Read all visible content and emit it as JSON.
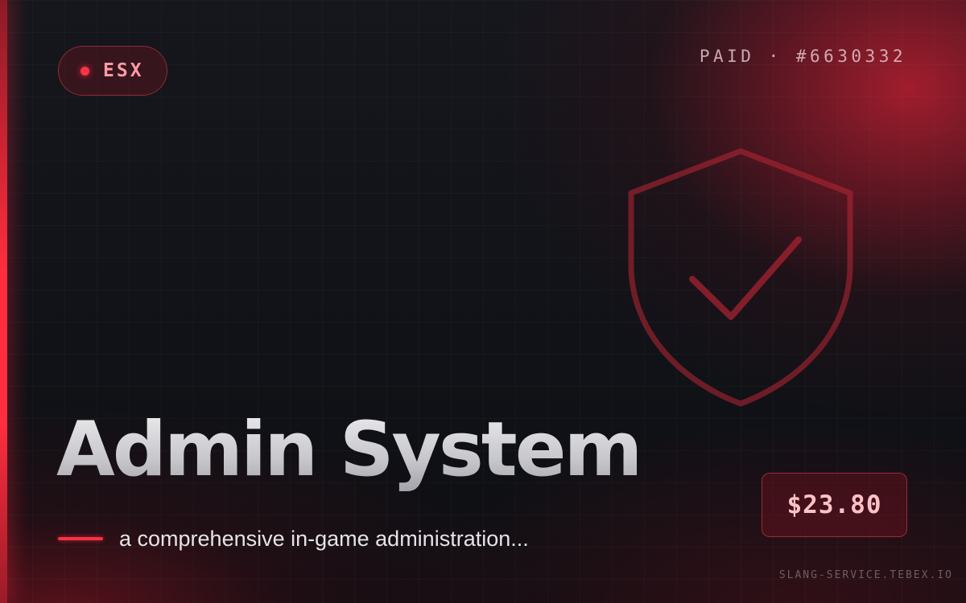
{
  "badge": {
    "label": "ESX"
  },
  "order": {
    "text": "PAID · #6630332"
  },
  "product": {
    "title": "Admin System",
    "description": "a comprehensive in-game administration...",
    "icon": "shield-check-icon"
  },
  "price": {
    "value": "$23.80"
  },
  "footer": {
    "domain": "SLANG-SERVICE.TEBEX.IO"
  },
  "colors": {
    "accent": "#ff2d3f",
    "background": "#0d0f14",
    "badge_text": "#ff9aa3",
    "price_text": "#ffc1c7"
  }
}
